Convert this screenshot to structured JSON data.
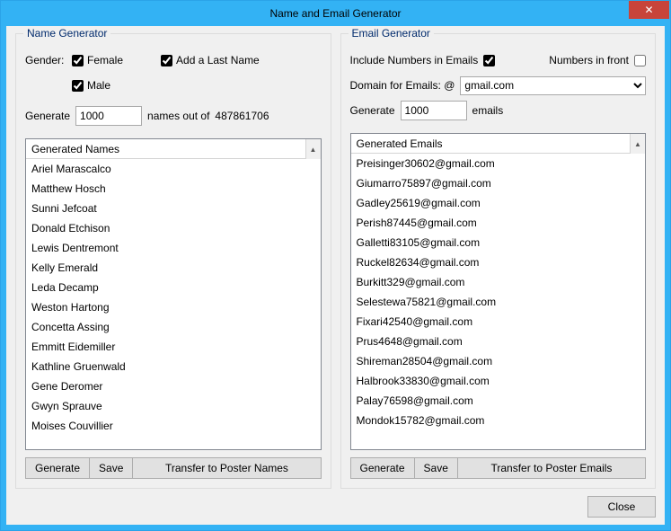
{
  "window": {
    "title": "Name and Email Generator",
    "close_glyph": "✕"
  },
  "names": {
    "legend": "Name Generator",
    "gender_label": "Gender:",
    "female_label": "Female",
    "female_checked": true,
    "male_label": "Male",
    "male_checked": true,
    "add_last_label": "Add a Last Name",
    "add_last_checked": true,
    "generate_label_prefix": "Generate",
    "generate_value": "1000",
    "generate_label_mid": "names out of",
    "total_names": "487861706",
    "list_header": "Generated Names",
    "items": [
      "Ariel Marascalco",
      "Matthew Hosch",
      "Sunni Jefcoat",
      "Donald Etchison",
      "Lewis Dentremont",
      "Kelly Emerald",
      "Leda Decamp",
      "Weston Hartong",
      "Concetta Assing",
      "Emmitt Eidemiller",
      "Kathline Gruenwald",
      "Gene Deromer",
      "Gwyn Sprauve",
      "Moises Couvillier"
    ],
    "btn_generate": "Generate",
    "btn_save": "Save",
    "btn_transfer": "Transfer to Poster Names"
  },
  "emails": {
    "legend": "Email Generator",
    "include_numbers_label": "Include Numbers in Emails",
    "include_numbers_checked": true,
    "numbers_front_label": "Numbers in front",
    "numbers_front_checked": false,
    "domain_label": "Domain for Emails: @",
    "domain_value": "gmail.com",
    "generate_label_prefix": "Generate",
    "generate_value": "1000",
    "generate_label_suffix": "emails",
    "list_header": "Generated Emails",
    "items": [
      "Preisinger30602@gmail.com",
      "Giumarro75897@gmail.com",
      "Gadley25619@gmail.com",
      "Perish87445@gmail.com",
      "Galletti83105@gmail.com",
      "Ruckel82634@gmail.com",
      "Burkitt329@gmail.com",
      "Selestewa75821@gmail.com",
      "Fixari42540@gmail.com",
      "Prus4648@gmail.com",
      "Shireman28504@gmail.com",
      "Halbrook33830@gmail.com",
      "Palay76598@gmail.com",
      "Mondok15782@gmail.com"
    ],
    "btn_generate": "Generate",
    "btn_save": "Save",
    "btn_transfer": "Transfer to Poster Emails"
  },
  "footer": {
    "close": "Close"
  }
}
